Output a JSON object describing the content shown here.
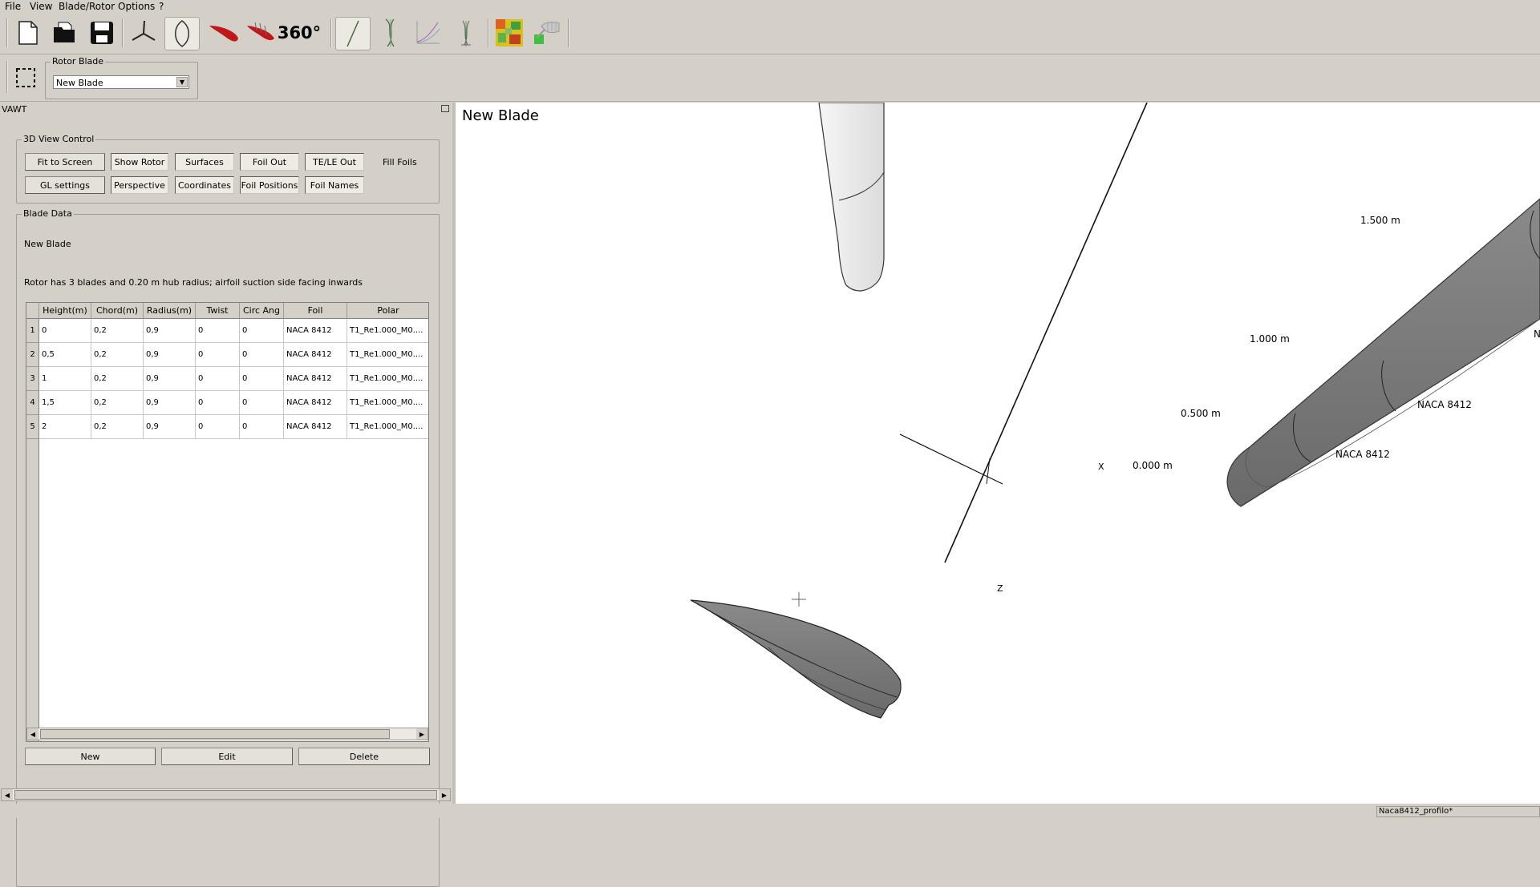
{
  "menu": [
    {
      "label": "File"
    },
    {
      "label": "View"
    },
    {
      "label": "Blade/Rotor"
    },
    {
      "label": "Options"
    },
    {
      "label": "?"
    }
  ],
  "toolbar": {
    "icons": [
      "new-file-icon",
      "open-folder-icon",
      "save-icon",
      "hawt-rotor-icon",
      "vawt-blade-icon",
      "airfoil-icon",
      "polar-blade-icon",
      "polar-360-icon",
      "line-icon",
      "vawt-curve-icon",
      "curve-plot-icon",
      "turbine-sim-icon",
      "field-map-icon",
      "hand-cursor-icon"
    ],
    "label_360": "360°"
  },
  "rotor_blade": {
    "group_title": "Rotor Blade",
    "selected": "New Blade"
  },
  "dock": {
    "title": "VAWT",
    "view_control": {
      "title": "3D View Control",
      "buttons_row1": [
        "Fit to Screen",
        "Show Rotor",
        "Surfaces",
        "Foil Out",
        "TE/LE Out"
      ],
      "fill_foils": "Fill Foils",
      "buttons_row2": [
        "GL settings",
        "Perspective",
        "Coordinates",
        "Foil Positions",
        "Foil Names"
      ]
    },
    "blade_data": {
      "title": "Blade Data",
      "blade_name": "New Blade",
      "description": "Rotor has 3 blades and 0.20 m hub radius; airfoil suction side facing inwards",
      "columns": [
        "Height(m)",
        "Chord(m)",
        "Radius(m)",
        "Twist",
        "Circ Ang",
        "Foil",
        "Polar"
      ],
      "rows": [
        {
          "num": "1",
          "cells": [
            "0",
            "0,2",
            "0,9",
            "0",
            "0",
            "NACA 8412",
            "T1_Re1.000_M0...."
          ]
        },
        {
          "num": "2",
          "cells": [
            "0,5",
            "0,2",
            "0,9",
            "0",
            "0",
            "NACA 8412",
            "T1_Re1.000_M0...."
          ]
        },
        {
          "num": "3",
          "cells": [
            "1",
            "0,2",
            "0,9",
            "0",
            "0",
            "NACA 8412",
            "T1_Re1.000_M0...."
          ]
        },
        {
          "num": "4",
          "cells": [
            "1,5",
            "0,2",
            "0,9",
            "0",
            "0",
            "NACA 8412",
            "T1_Re1.000_M0...."
          ]
        },
        {
          "num": "5",
          "cells": [
            "2",
            "0,2",
            "0,9",
            "0",
            "0",
            "NACA 8412",
            "T1_Re1.000_M0...."
          ]
        }
      ],
      "buttons": [
        "New",
        "Edit",
        "Delete"
      ]
    }
  },
  "viewport": {
    "title": "New Blade",
    "labels": {
      "m1500": "1.500 m",
      "m1000": "1.000 m",
      "m0500": "0.500 m",
      "m0000": "0.000 m",
      "axis_x": "X",
      "axis_z": "Z",
      "foil_a": "NACA 8412",
      "foil_b": "NACA 8412",
      "foil_c_partial": "N"
    }
  },
  "status": {
    "right_text": "Naca8412_profilo*"
  }
}
